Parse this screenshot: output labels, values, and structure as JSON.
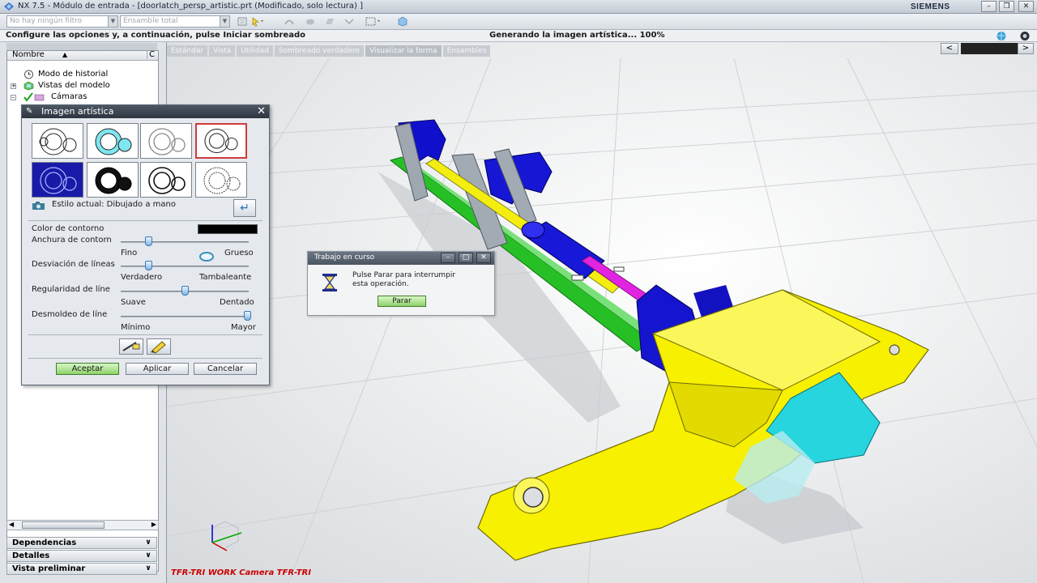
{
  "window": {
    "title": "NX 7.5 - Módulo de entrada - [doorlatch_persp_artistic.prt (Modificado, solo lectura) ]",
    "brand": "SIEMENS"
  },
  "toolbar": {
    "filter_combo": "No hay ningún filtro",
    "assembly_combo": "Ensamble total"
  },
  "cue_line": {
    "prompt": "Configure las opciones y, a continuación, pulse Iniciar sombreado",
    "status": "Generando la imagen artística... 100%"
  },
  "graphics": {
    "tabs": [
      "Estándar",
      "Vista",
      "Utilidad",
      "Sombreado verdadero",
      "Visualizar la forma",
      "Ensambles"
    ],
    "camera_label": "TFR-TRI WORK Camera TFR-TRI"
  },
  "navigator": {
    "col_name": "Nombre",
    "col_short": "C",
    "items": [
      {
        "label": "Modo de historial"
      },
      {
        "label": "Vistas del modelo"
      },
      {
        "label": "Cámaras"
      }
    ],
    "panels": [
      "Dependencias",
      "Detalles",
      "Vista preliminar"
    ]
  },
  "art_dialog": {
    "title": "Imagen artística",
    "current_style": "Estilo actual: Dibujado a mano",
    "outline_color_label": "Color de contorno",
    "outline_color": "#000000",
    "sliders": [
      {
        "label": "Anchura de contorn",
        "min_label": "Fino",
        "max_label": "Grueso",
        "value": 0.05
      },
      {
        "label": "Desviación de líneas",
        "min_label": "Verdadero",
        "max_label": "Tambaleante",
        "value": 0.05
      },
      {
        "label": "Regularidad de líne",
        "min_label": "Suave",
        "max_label": "Dentado",
        "value": 0.4
      },
      {
        "label": "Desmoldeo de líne",
        "min_label": "Mínimo",
        "max_label": "Mayor",
        "value": 1.0
      }
    ],
    "buttons": {
      "ok": "Aceptar",
      "apply": "Aplicar",
      "cancel": "Cancelar"
    }
  },
  "progress_dialog": {
    "title": "Trabajo en curso",
    "message_line1": "Pulse Parar para interrumpir",
    "message_line2": "esta operación.",
    "stop_button": "Parar"
  },
  "colors": {
    "part_yellow": "#f7f000",
    "part_blue": "#1a1adc",
    "part_green": "#28c828",
    "part_cyan": "#2ad8e0",
    "part_magenta": "#e020e0",
    "accept_green": "#8fd16a"
  }
}
